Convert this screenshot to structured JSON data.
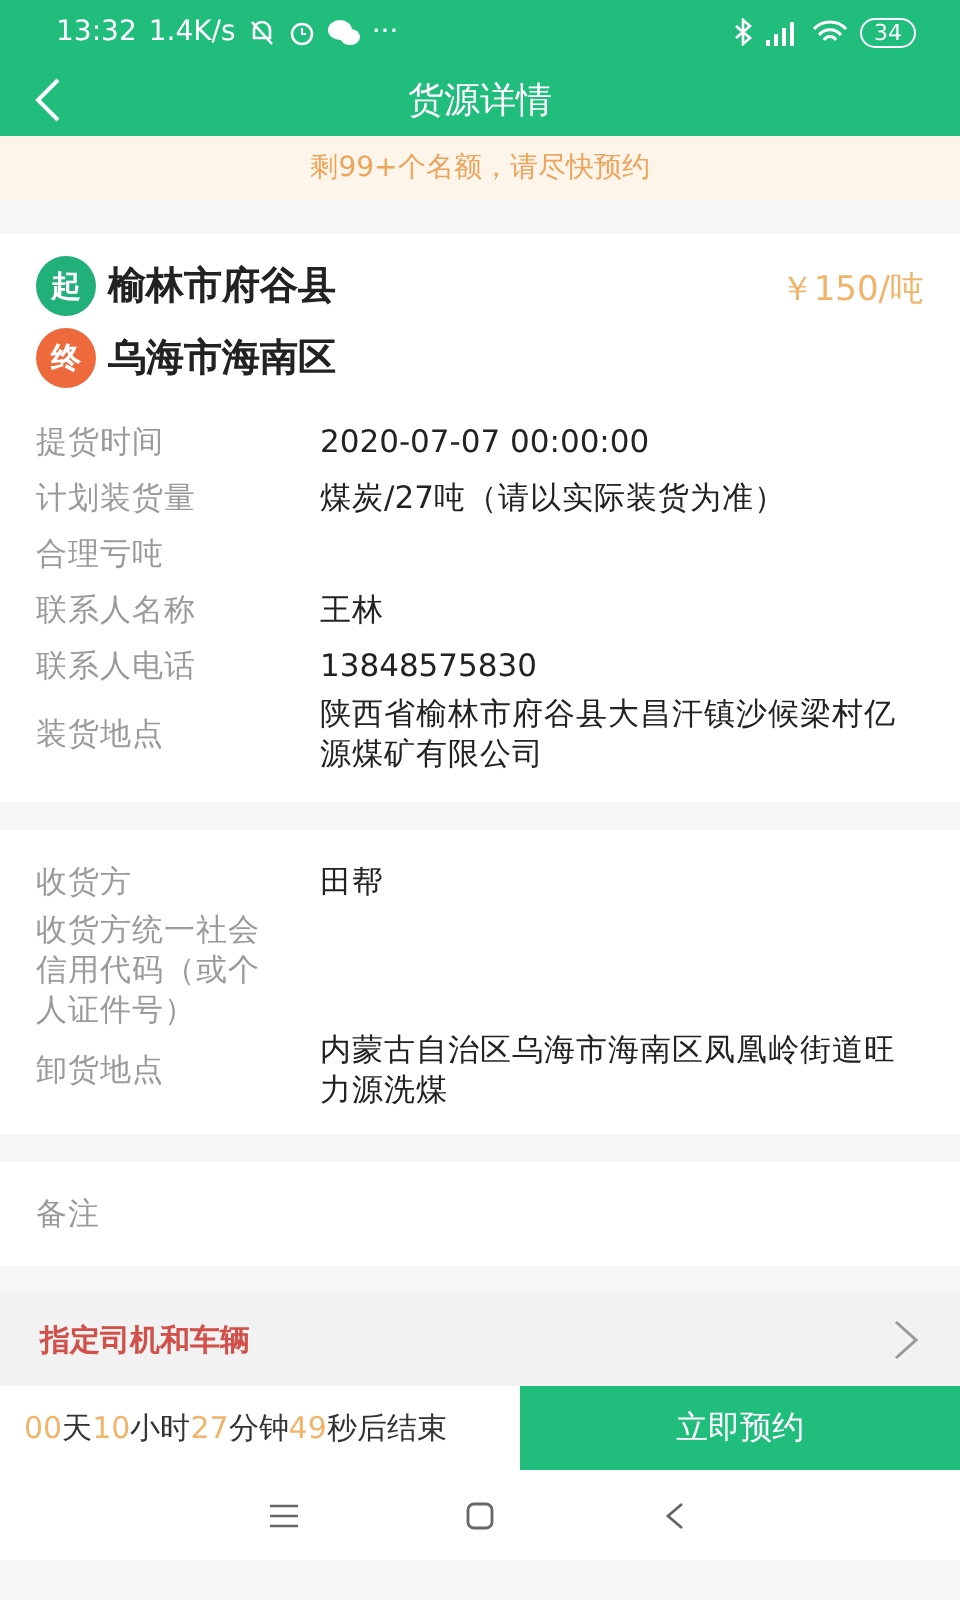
{
  "status_bar": {
    "time": "13:32",
    "speed": "1.4K/s",
    "dots": "···",
    "battery": "34"
  },
  "header": {
    "title": "货源详情"
  },
  "notice": "剩99+个名额，请尽快预约",
  "route": {
    "start_tag": "起",
    "start": "榆林市府谷县",
    "end_tag": "终",
    "end": "乌海市海南区",
    "price": "￥150/吨"
  },
  "sections": [
    {
      "rows": [
        {
          "label": "提货时间",
          "value": "2020-07-07 00:00:00"
        },
        {
          "label": "计划装货量",
          "value": "煤炭/27吨（请以实际装货为准）"
        },
        {
          "label": "合理亏吨"
        },
        {
          "label": "联系人名称",
          "value": "王林"
        },
        {
          "label": "联系人电话",
          "value": "13848575830"
        },
        {
          "label": "装货地点",
          "value": "陕西省榆林市府谷县大昌汗镇沙候梁村亿源煤矿有限公司"
        }
      ]
    },
    {
      "rows": [
        {
          "label": "收货方",
          "value": "田帮"
        },
        {
          "label": "收货方统一社会信用代码（或个人证件号）"
        },
        {
          "label": "卸货地点",
          "value": "内蒙古自治区乌海市海南区凤凰岭街道旺力源洗煤"
        }
      ]
    },
    {
      "rows": [
        {
          "label": "备注"
        }
      ]
    }
  ],
  "assign": {
    "label": "指定司机和车辆"
  },
  "countdown": [
    {
      "value": "00",
      "unit": "天"
    },
    {
      "value": "10",
      "unit": "小时"
    },
    {
      "value": "27",
      "unit": "分钟"
    },
    {
      "value": "49",
      "unit": "秒后结束"
    }
  ],
  "book_button": "立即预约"
}
